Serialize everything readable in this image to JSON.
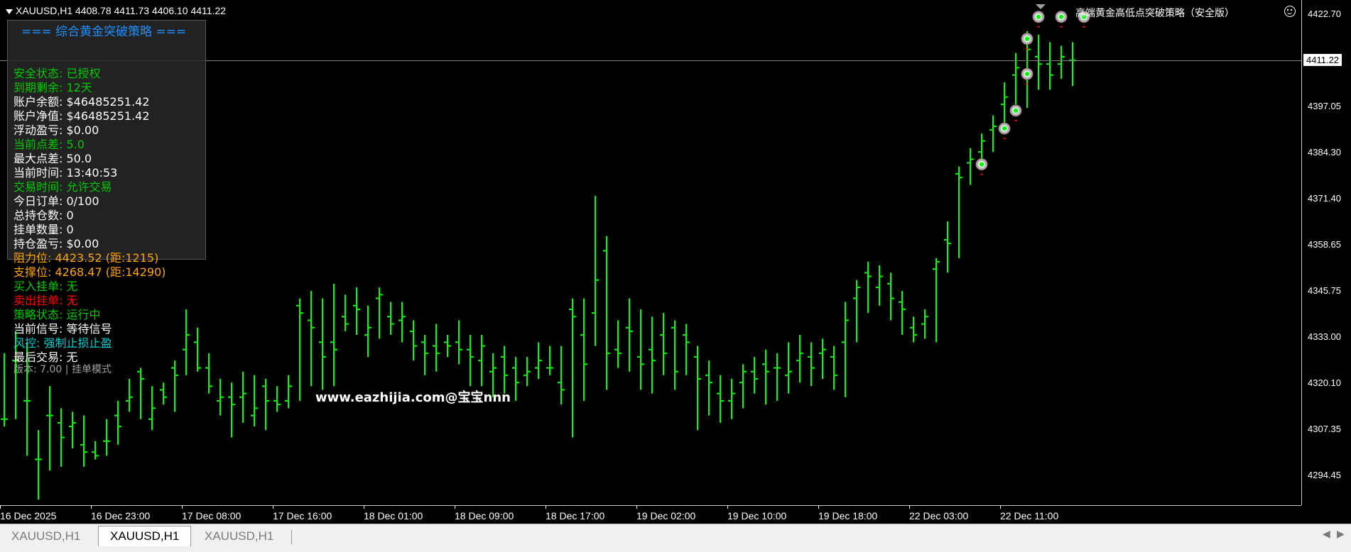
{
  "window": {
    "symbol_header": "XAUUSD,H1  4408.78 4411.73 4406.10 4411.22",
    "ea_title": "高端黄金高低点突破策略（安全版）"
  },
  "panel": {
    "title": "=== 综合黄金突破策略 ===",
    "lines": [
      {
        "text": "安全状态: 已授权",
        "color": "#00c800"
      },
      {
        "text": "到期剩余: 12天",
        "color": "#00c800"
      },
      {
        "text": "账户余额: $46485251.42",
        "color": "#ffffff"
      },
      {
        "text": "账户净值: $46485251.42",
        "color": "#ffffff"
      },
      {
        "text": "浮动盈亏: $0.00",
        "color": "#ffffff"
      },
      {
        "text": "当前点差: 5.0",
        "color": "#00c800"
      },
      {
        "text": "最大点差: 50.0",
        "color": "#ffffff"
      },
      {
        "text": "当前时间: 13:40:53",
        "color": "#ffffff"
      },
      {
        "text": "交易时间: 允许交易",
        "color": "#00c800"
      },
      {
        "text": "今日订单: 0/100",
        "color": "#ffffff"
      },
      {
        "text": "总持仓数: 0",
        "color": "#ffffff"
      },
      {
        "text": "挂单数量: 0",
        "color": "#ffffff"
      },
      {
        "text": "持仓盈亏: $0.00",
        "color": "#ffffff"
      },
      {
        "text": "阻力位: 4423.52 (距:1215)",
        "color": "#ffa500"
      },
      {
        "text": "支撑位: 4268.47 (距:14290)",
        "color": "#ffa500"
      },
      {
        "text": "买入挂单: 无",
        "color": "#00c800"
      },
      {
        "text": "卖出挂单: 无",
        "color": "#ff0000"
      },
      {
        "text": "策略状态: 运行中",
        "color": "#00c800"
      },
      {
        "text": "当前信号: 等待信号",
        "color": "#ffffff"
      },
      {
        "text": "风控: 强制止损止盈",
        "color": "#00ced1"
      },
      {
        "text": "最后交易: 无",
        "color": "#ffffff"
      },
      {
        "text": "版本: 7.00 | 挂单模式",
        "color": "#a0a0a0"
      }
    ]
  },
  "watermark": "www.eazhijia.com@宝宝nnn",
  "price_axis": {
    "ticks": [
      "4422.70",
      "4397.05",
      "4384.30",
      "4371.40",
      "4358.65",
      "4345.75",
      "4333.00",
      "4320.10",
      "4307.35",
      "4294.45"
    ],
    "current_price": "4411.22"
  },
  "time_axis": {
    "ticks": [
      "16 Dec 2025",
      "16 Dec 23:00",
      "17 Dec 08:00",
      "17 Dec 16:00",
      "18 Dec 01:00",
      "18 Dec 09:00",
      "18 Dec 17:00",
      "19 Dec 02:00",
      "19 Dec 10:00",
      "19 Dec 18:00",
      "22 Dec 03:00",
      "22 Dec 11:00"
    ]
  },
  "tabs": [
    {
      "label": "XAUUSD,H1",
      "active": false
    },
    {
      "label": "XAUUSD,H1",
      "active": true
    },
    {
      "label": "XAUUSD,H1",
      "active": false
    }
  ],
  "chart_data": {
    "type": "ohlc",
    "color": "#00ff00",
    "ylim": [
      4289.5,
      4427.5
    ],
    "bars": [
      [
        4313,
        4331,
        4311,
        4313
      ],
      [
        4329,
        4337,
        4313,
        4329
      ],
      [
        4318,
        4334,
        4303,
        4318
      ],
      [
        4302,
        4310,
        4291,
        4302
      ],
      [
        4314,
        4322,
        4299,
        4314
      ],
      [
        4312,
        4316,
        4300,
        4308
      ],
      [
        4311,
        4315,
        4305,
        4312
      ],
      [
        4306,
        4314,
        4300,
        4304
      ],
      [
        4304,
        4307,
        4302,
        4303
      ],
      [
        4307,
        4313,
        4303,
        4307
      ],
      [
        4314,
        4318,
        4306,
        4311
      ],
      [
        4318,
        4324,
        4315,
        4319
      ],
      [
        4326,
        4327,
        4313,
        4324
      ],
      [
        4313,
        4322,
        4310,
        4316
      ],
      [
        4321,
        4323,
        4317,
        4319
      ],
      [
        4327,
        4329,
        4315,
        4325
      ],
      [
        4332,
        4343,
        4325,
        4336
      ],
      [
        4334,
        4338,
        4326,
        4327
      ],
      [
        4327,
        4331,
        4320,
        4322
      ],
      [
        4318,
        4324,
        4314,
        4319
      ],
      [
        4319,
        4323,
        4308,
        4317
      ],
      [
        4319,
        4326,
        4312,
        4320
      ],
      [
        4314,
        4325,
        4311,
        4316
      ],
      [
        4322,
        4324,
        4310,
        4318
      ],
      [
        4318,
        4322,
        4315,
        4317
      ],
      [
        4318,
        4325,
        4316,
        4322
      ],
      [
        4344,
        4346,
        4318,
        4342
      ],
      [
        4340,
        4348,
        4322,
        4338
      ],
      [
        4334,
        4346,
        4321,
        4330
      ],
      [
        4334,
        4350,
        4322,
        4332
      ],
      [
        4341,
        4347,
        4337,
        4339
      ],
      [
        4344,
        4349,
        4336,
        4343
      ],
      [
        4336,
        4344,
        4330,
        4338
      ],
      [
        4346,
        4349,
        4335,
        4347
      ],
      [
        4341,
        4345,
        4336,
        4339
      ],
      [
        4340,
        4345,
        4334,
        4341
      ],
      [
        4337,
        4340,
        4329,
        4333
      ],
      [
        4334,
        4336,
        4325,
        4331
      ],
      [
        4333,
        4339,
        4326,
        4331
      ],
      [
        4334,
        4336,
        4330,
        4333
      ],
      [
        4334,
        4340,
        4328,
        4332
      ],
      [
        4332,
        4336,
        4322,
        4330
      ],
      [
        4329,
        4336,
        4322,
        4333
      ],
      [
        4326,
        4331,
        4319,
        4327
      ],
      [
        4330,
        4333,
        4320,
        4325
      ],
      [
        4327,
        4330,
        4318,
        4323
      ],
      [
        4325,
        4330,
        4322,
        4326
      ],
      [
        4327,
        4334,
        4324,
        4329
      ],
      [
        4327,
        4333,
        4325,
        4327
      ],
      [
        4323,
        4333,
        4317,
        4321
      ],
      [
        4343,
        4346,
        4308,
        4341
      ],
      [
        4336,
        4346,
        4318,
        4328
      ],
      [
        4342,
        4374,
        4333,
        4351
      ],
      [
        4359,
        4363,
        4321,
        4331
      ],
      [
        4332,
        4340,
        4327,
        4331
      ],
      [
        4338,
        4346,
        4326,
        4337
      ],
      [
        4330,
        4343,
        4321,
        4328
      ],
      [
        4332,
        4341,
        4320,
        4329
      ],
      [
        4336,
        4342,
        4325,
        4331
      ],
      [
        4338,
        4340,
        4321,
        4326
      ],
      [
        4336,
        4339,
        4325,
        4334
      ],
      [
        4330,
        4333,
        4310,
        4324
      ],
      [
        4325,
        4329,
        4314,
        4323
      ],
      [
        4320,
        4325,
        4312,
        4318
      ],
      [
        4318,
        4324,
        4313,
        4320
      ],
      [
        4323,
        4328,
        4316,
        4326
      ],
      [
        4326,
        4330,
        4320,
        4324
      ],
      [
        4328,
        4332,
        4317,
        4326
      ],
      [
        4327,
        4331,
        4318,
        4327
      ],
      [
        4325,
        4334,
        4320,
        4326
      ],
      [
        4329,
        4336,
        4323,
        4331
      ],
      [
        4330,
        4334,
        4322,
        4327
      ],
      [
        4331,
        4335,
        4324,
        4332
      ],
      [
        4330,
        4333,
        4321,
        4325
      ],
      [
        4334,
        4345,
        4319,
        4340
      ],
      [
        4346,
        4351,
        4334,
        4349
      ],
      [
        4353,
        4356,
        4342,
        4352
      ],
      [
        4349,
        4355,
        4344,
        4352
      ],
      [
        4350,
        4353,
        4340,
        4346
      ],
      [
        4345,
        4348,
        4336,
        4343
      ],
      [
        4338,
        4341,
        4334,
        4336
      ],
      [
        4339,
        4343,
        4335,
        4341
      ],
      [
        4354,
        4357,
        4334,
        4356
      ],
      [
        4362,
        4367,
        4353,
        4361
      ],
      [
        4380,
        4382,
        4357,
        4379
      ],
      [
        4383,
        4387,
        4377,
        4384
      ],
      [
        4386,
        4391,
        4381,
        4389
      ],
      [
        4392,
        4396,
        4386,
        4393
      ],
      [
        4399,
        4405,
        4394,
        4401
      ],
      [
        4407,
        4413,
        4399,
        4409
      ],
      [
        4416,
        4419,
        4398,
        4414
      ],
      [
        4412,
        4418,
        4403,
        4410
      ],
      [
        4410,
        4416,
        4403,
        4407
      ],
      [
        4410,
        4415,
        4406,
        4412
      ],
      [
        4411,
        4416,
        4404,
        4411
      ]
    ],
    "markers": [
      {
        "bar": 86,
        "price": 4382.6
      },
      {
        "bar": 88,
        "price": 4392.4
      },
      {
        "bar": 89,
        "price": 4397.3
      },
      {
        "bar": 90,
        "price": 4407.3
      },
      {
        "bar": 90,
        "price": 4416.9
      },
      {
        "bar": 91,
        "price": 4422.9
      },
      {
        "bar": 93,
        "price": 4422.9
      },
      {
        "bar": 95,
        "price": 4422.9
      }
    ]
  }
}
